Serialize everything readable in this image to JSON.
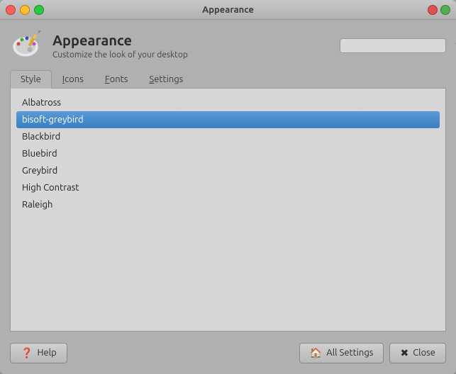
{
  "window": {
    "title": "Appearance"
  },
  "header": {
    "app_title": "Appearance",
    "app_subtitle": "Customize the look of your desktop",
    "search_placeholder": ""
  },
  "tabs": [
    {
      "label": "Style",
      "underline": "S",
      "active": true,
      "id": "style"
    },
    {
      "label": "Icons",
      "underline": "I",
      "active": false,
      "id": "icons"
    },
    {
      "label": "Fonts",
      "underline": "F",
      "active": false,
      "id": "fonts"
    },
    {
      "label": "Settings",
      "underline": "S",
      "active": false,
      "id": "settings"
    }
  ],
  "theme_list": [
    {
      "name": "Albatross",
      "selected": false
    },
    {
      "name": "bisoft-greybird",
      "selected": true
    },
    {
      "name": "Blackbird",
      "selected": false
    },
    {
      "name": "Bluebird",
      "selected": false
    },
    {
      "name": "Greybird",
      "selected": false
    },
    {
      "name": "High Contrast",
      "selected": false
    },
    {
      "name": "Raleigh",
      "selected": false
    }
  ],
  "footer": {
    "help_label": "Help",
    "all_settings_label": "All Settings",
    "close_label": "Close"
  }
}
